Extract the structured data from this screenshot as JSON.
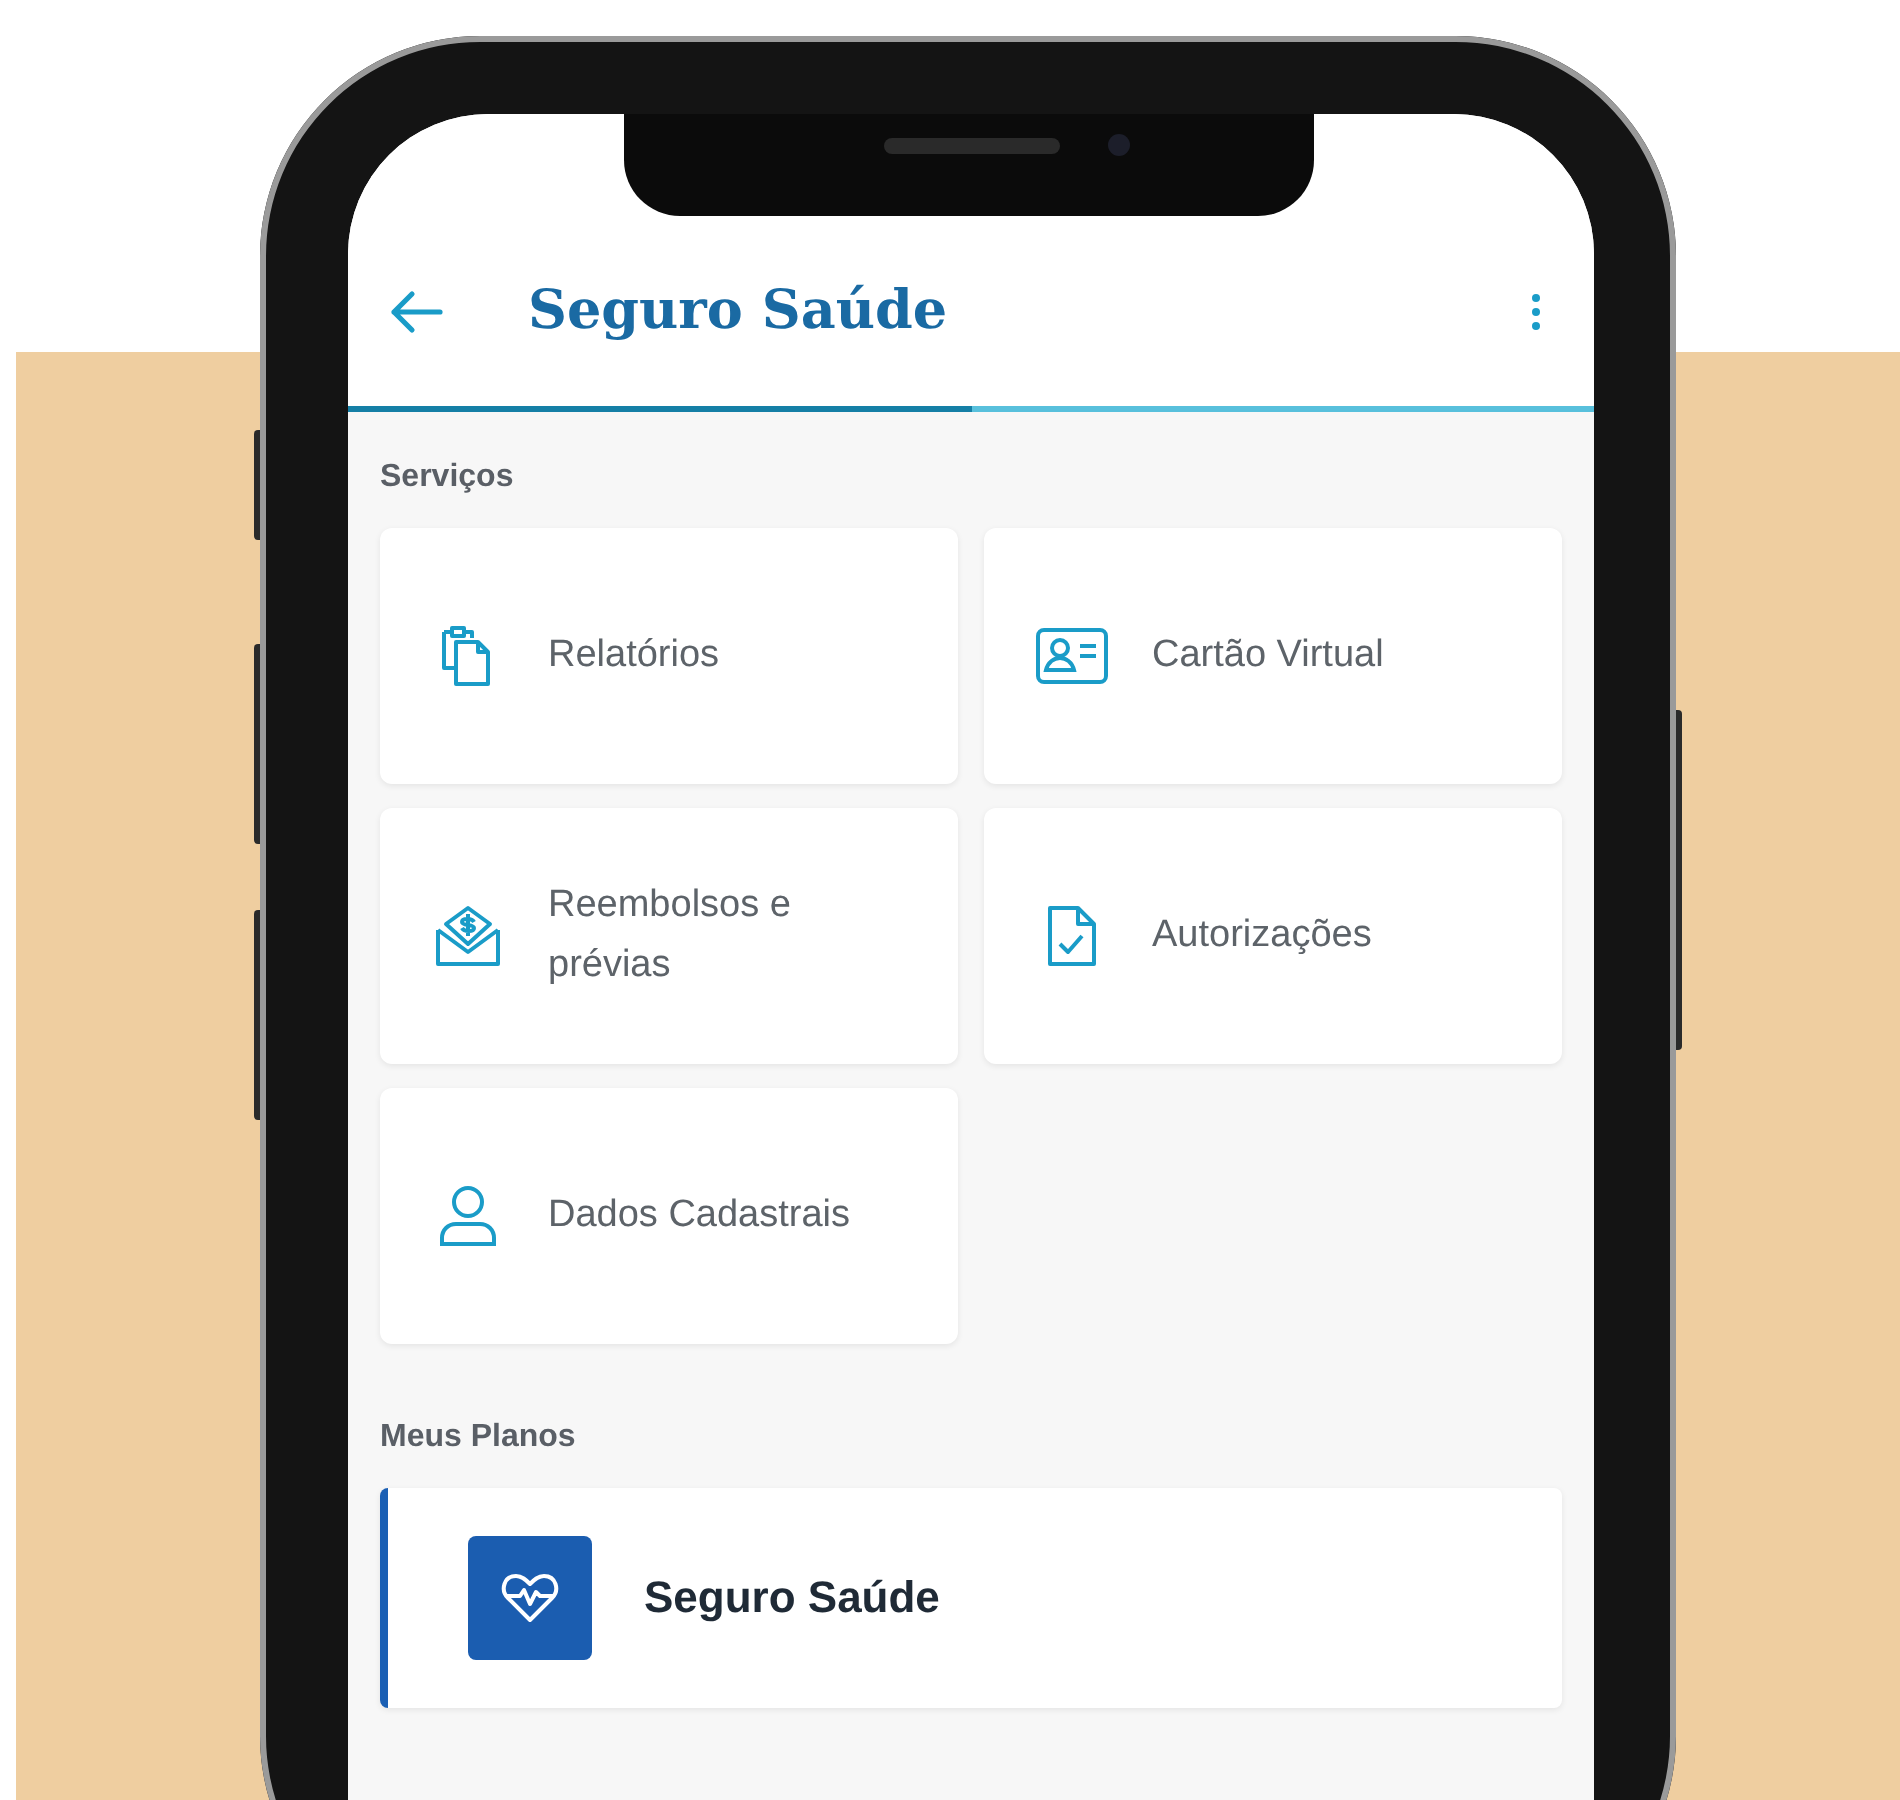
{
  "app_bar": {
    "title": "Seguro Saúde",
    "progress": {
      "level": 0.5
    }
  },
  "services_section": {
    "title": "Serviços",
    "items": [
      {
        "label": "Relatórios",
        "kind": "clipboards"
      },
      {
        "label": "Cartão Virtual",
        "kind": "id-card"
      },
      {
        "label": "Reembolsos e prévias",
        "kind": "money-envelope"
      },
      {
        "label": "Autorizações",
        "kind": "document-check"
      },
      {
        "label": "Dados Cadastrais",
        "kind": "person"
      }
    ]
  },
  "plans_section": {
    "title": "Meus Planos",
    "items": [
      {
        "name": "Seguro Saúde",
        "kind": "heart-pulse"
      }
    ]
  }
}
